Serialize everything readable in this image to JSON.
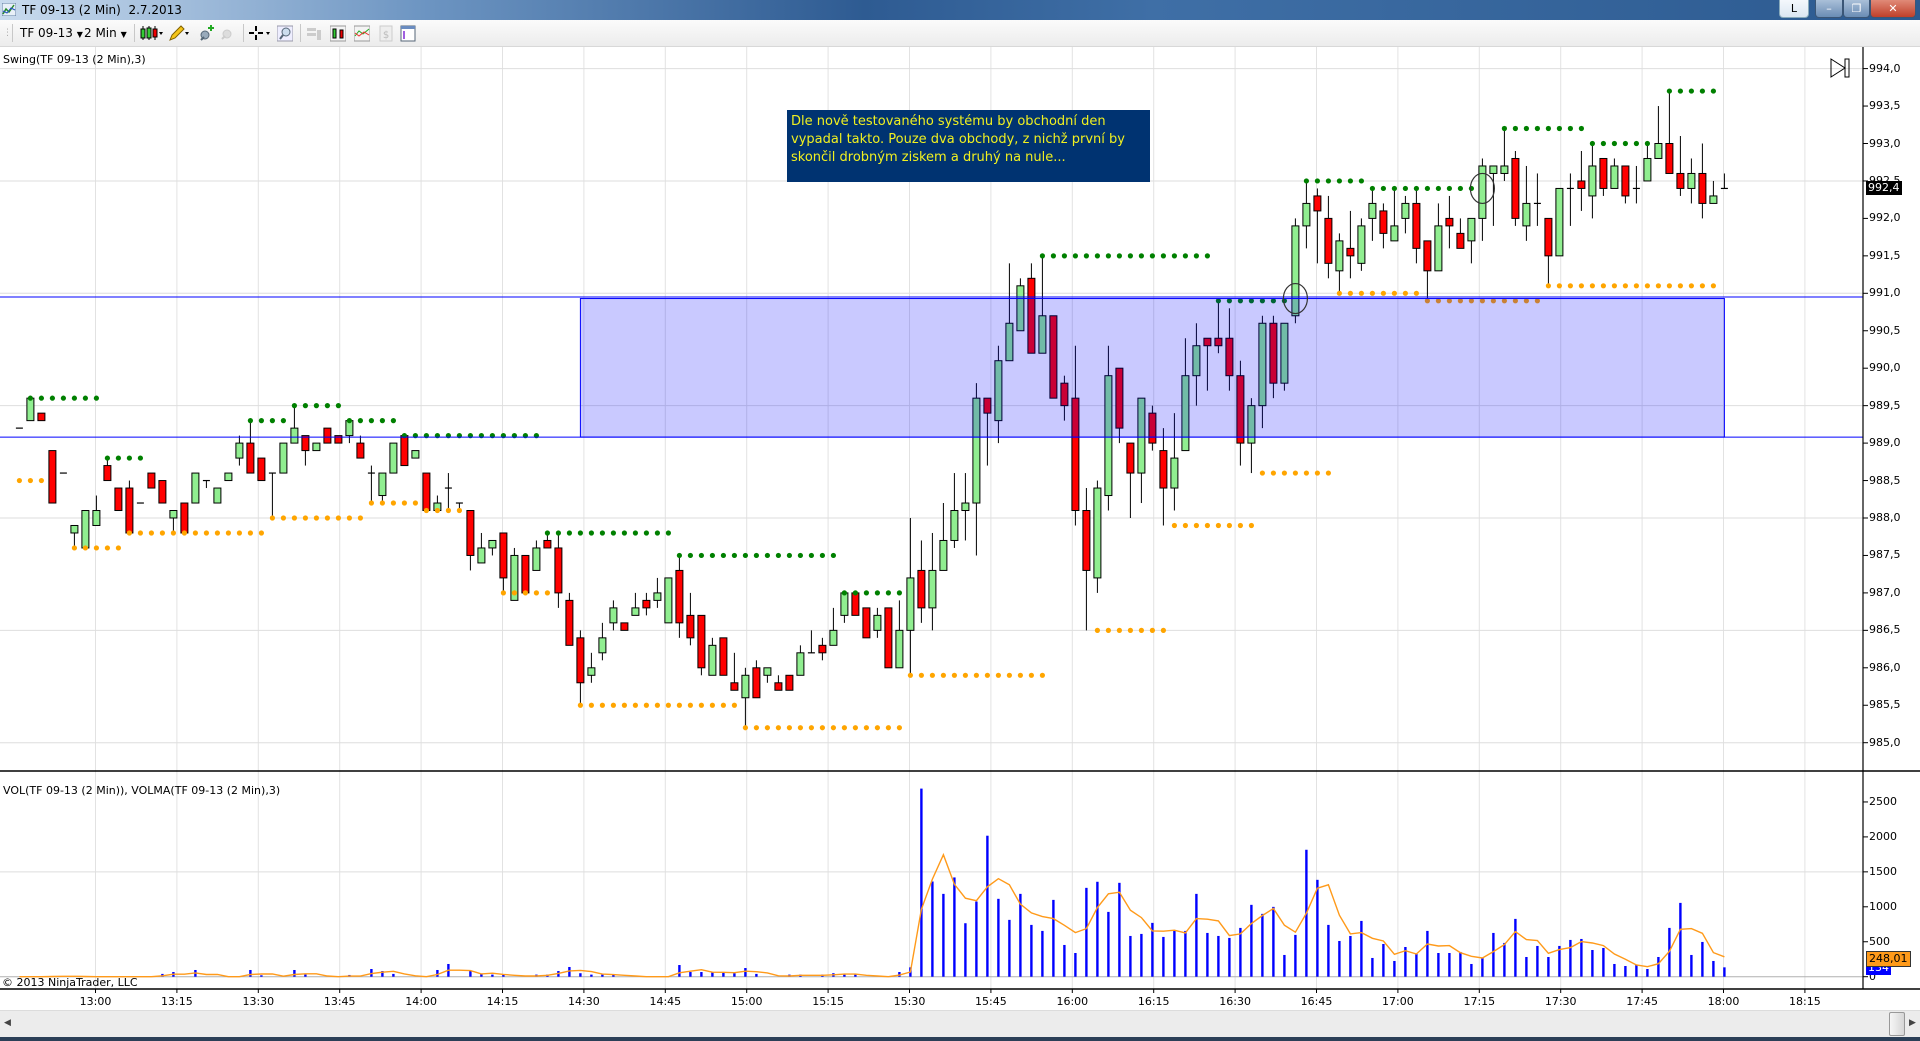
{
  "window": {
    "title": "TF 09-13 (2 Min)  2.7.2013",
    "link_button": "L"
  },
  "toolbar": {
    "instrument": "TF 09-13",
    "interval": "2 Min"
  },
  "labels": {
    "price_indicator": "Swing(TF 09-13 (2 Min),3)",
    "volume_indicator": "VOL(TF 09-13 (2 Min)), VOLMA(TF 09-13 (2 Min),3)",
    "copyright": "© 2013 NinjaTrader, LLC"
  },
  "annotation": {
    "text": "Dle nově testovaného systému by obchodní den vypadal takto. Pouze dva obchody, z nichž první by skončil drobným ziskem a druhý na nule..."
  },
  "colors": {
    "up": "#90ee90",
    "down": "#ff0000",
    "swing_high": "#008000",
    "swing_low": "#ffa500",
    "volume": "#0000ff",
    "volma": "#ff9a1a",
    "zone": "#0000ff",
    "annotation_bg": "#003371",
    "annotation_text": "#f0f020"
  },
  "markers": {
    "last_price": "992,4",
    "last_volma": "248,01",
    "last_volume": "134"
  },
  "chart_data": {
    "type": "candlestick",
    "instrument": "TF 09-13",
    "price_axis": {
      "min": 985.0,
      "max": 994.0,
      "step": 0.5,
      "labels": [
        "994,0",
        "993,5",
        "993,0",
        "992,5",
        "992,0",
        "991,5",
        "991,0",
        "990,5",
        "990,0",
        "989,5",
        "989,0",
        "988,5",
        "988,0",
        "987,5",
        "987,0",
        "986,5",
        "986,0",
        "985,5",
        "985,0"
      ],
      "grid_step": 1.5
    },
    "volume_axis": {
      "labels": [
        "2500",
        "2000",
        "1500",
        "1000",
        "500",
        "0"
      ],
      "values": [
        2500,
        2000,
        1500,
        1000,
        500,
        0
      ],
      "grid": [
        1500
      ]
    },
    "time_labels": [
      "13:00",
      "13:15",
      "13:30",
      "13:45",
      "14:00",
      "14:15",
      "14:30",
      "14:45",
      "15:00",
      "15:15",
      "15:30",
      "15:45",
      "16:00",
      "16:15",
      "16:30",
      "16:45",
      "17:00",
      "17:15",
      "17:30",
      "17:45",
      "18:00",
      "18:15"
    ],
    "candles_ohlc": [
      [
        989.2,
        989.2,
        989.2,
        989.2
      ],
      [
        989.3,
        989.6,
        989.3,
        989.6
      ],
      [
        989.4,
        989.4,
        989.3,
        989.3
      ],
      [
        988.9,
        988.9,
        988.2,
        988.2
      ],
      [
        988.6,
        988.6,
        988.6,
        988.6
      ],
      [
        987.8,
        987.9,
        987.6,
        987.9
      ],
      [
        987.6,
        988.1,
        987.6,
        988.1
      ],
      [
        987.9,
        988.3,
        987.9,
        988.1
      ],
      [
        988.7,
        988.8,
        988.5,
        988.5
      ],
      [
        988.4,
        988.4,
        988.1,
        988.1
      ],
      [
        988.4,
        988.5,
        987.8,
        987.8
      ],
      [
        988.2,
        988.2,
        988.2,
        988.2
      ],
      [
        988.6,
        988.6,
        988.4,
        988.4
      ],
      [
        988.5,
        988.5,
        988.2,
        988.2
      ],
      [
        988.0,
        988.1,
        987.8,
        988.1
      ],
      [
        988.2,
        988.2,
        987.8,
        987.8
      ],
      [
        988.2,
        988.6,
        988.2,
        988.6
      ],
      [
        988.5,
        988.5,
        988.4,
        988.5
      ],
      [
        988.2,
        988.4,
        988.2,
        988.4
      ],
      [
        988.5,
        988.6,
        988.5,
        988.6
      ],
      [
        988.8,
        989.1,
        988.7,
        989.0
      ],
      [
        989.0,
        989.3,
        988.6,
        988.6
      ],
      [
        988.8,
        988.8,
        988.5,
        988.5
      ],
      [
        988.6,
        988.6,
        988.0,
        988.6
      ],
      [
        988.6,
        989.0,
        988.6,
        989.0
      ],
      [
        989.0,
        989.5,
        989.0,
        989.2
      ],
      [
        989.1,
        989.1,
        988.7,
        988.9
      ],
      [
        988.9,
        989.0,
        988.9,
        989.0
      ],
      [
        989.2,
        989.2,
        989.0,
        989.0
      ],
      [
        989.1,
        989.1,
        989.0,
        989.0
      ],
      [
        989.1,
        989.3,
        989.0,
        989.3
      ],
      [
        989.0,
        989.1,
        988.8,
        988.8
      ],
      [
        988.6,
        988.7,
        988.2,
        988.6
      ],
      [
        988.3,
        988.6,
        988.2,
        988.6
      ],
      [
        988.6,
        989.0,
        988.6,
        989.0
      ],
      [
        989.1,
        989.1,
        988.7,
        988.7
      ],
      [
        988.8,
        988.9,
        988.8,
        988.9
      ],
      [
        988.6,
        988.6,
        988.1,
        988.1
      ],
      [
        988.1,
        988.3,
        988.1,
        988.2
      ],
      [
        988.4,
        988.6,
        988.1,
        988.4
      ],
      [
        988.2,
        988.2,
        988.1,
        988.2
      ],
      [
        988.1,
        988.1,
        987.3,
        987.5
      ],
      [
        987.4,
        987.8,
        987.4,
        987.6
      ],
      [
        987.6,
        987.7,
        987.5,
        987.7
      ],
      [
        987.8,
        987.8,
        987.0,
        987.2
      ],
      [
        986.9,
        987.6,
        986.9,
        987.5
      ],
      [
        987.5,
        987.5,
        987.0,
        987.0
      ],
      [
        987.3,
        987.7,
        987.3,
        987.6
      ],
      [
        987.7,
        987.8,
        987.6,
        987.6
      ],
      [
        987.6,
        987.8,
        986.8,
        987.0
      ],
      [
        986.9,
        987.0,
        986.3,
        986.3
      ],
      [
        986.4,
        986.5,
        985.5,
        985.8
      ],
      [
        985.9,
        986.2,
        985.8,
        986.0
      ],
      [
        986.2,
        986.6,
        986.1,
        986.4
      ],
      [
        986.6,
        986.9,
        986.5,
        986.8
      ],
      [
        986.6,
        986.6,
        986.5,
        986.5
      ],
      [
        986.7,
        987.0,
        986.7,
        986.8
      ],
      [
        986.9,
        987.0,
        986.7,
        986.8
      ],
      [
        986.9,
        987.2,
        986.8,
        987.0
      ],
      [
        986.6,
        987.2,
        986.6,
        987.2
      ],
      [
        987.3,
        987.5,
        986.4,
        986.6
      ],
      [
        986.7,
        987.0,
        986.3,
        986.4
      ],
      [
        986.7,
        986.7,
        985.9,
        986.0
      ],
      [
        985.9,
        986.4,
        985.9,
        986.3
      ],
      [
        986.4,
        986.4,
        985.9,
        985.9
      ],
      [
        985.8,
        986.2,
        985.7,
        985.7
      ],
      [
        985.6,
        986.0,
        985.2,
        985.9
      ],
      [
        986.0,
        986.1,
        985.6,
        985.6
      ],
      [
        985.9,
        986.0,
        985.8,
        986.0
      ],
      [
        985.8,
        985.9,
        985.7,
        985.7
      ],
      [
        985.9,
        985.9,
        985.7,
        985.7
      ],
      [
        985.9,
        986.3,
        985.9,
        986.2
      ],
      [
        986.2,
        986.5,
        986.2,
        986.2
      ],
      [
        986.3,
        986.4,
        986.1,
        986.2
      ],
      [
        986.3,
        986.8,
        986.3,
        986.5
      ],
      [
        986.7,
        987.0,
        986.6,
        987.0
      ],
      [
        987.0,
        987.0,
        986.7,
        986.7
      ],
      [
        986.8,
        986.8,
        986.4,
        986.4
      ],
      [
        986.5,
        986.8,
        986.4,
        986.7
      ],
      [
        986.8,
        986.8,
        986.0,
        986.0
      ],
      [
        986.0,
        986.9,
        986.0,
        986.5
      ],
      [
        986.5,
        988.0,
        985.9,
        987.2
      ],
      [
        987.3,
        987.7,
        986.6,
        986.8
      ],
      [
        986.8,
        987.8,
        986.5,
        987.3
      ],
      [
        987.3,
        988.2,
        987.3,
        987.7
      ],
      [
        987.7,
        988.6,
        987.6,
        988.1
      ],
      [
        988.1,
        988.6,
        987.7,
        988.2
      ],
      [
        988.2,
        989.8,
        987.5,
        989.6
      ],
      [
        989.6,
        989.6,
        988.7,
        989.4
      ],
      [
        989.3,
        990.3,
        989.0,
        990.1
      ],
      [
        990.1,
        991.4,
        990.1,
        990.6
      ],
      [
        990.5,
        991.2,
        990.5,
        991.1
      ],
      [
        991.2,
        991.4,
        990.2,
        990.2
      ],
      [
        990.2,
        991.5,
        990.2,
        990.7
      ],
      [
        990.7,
        990.7,
        989.6,
        989.6
      ],
      [
        989.8,
        989.9,
        989.3,
        989.5
      ],
      [
        989.6,
        990.3,
        987.9,
        988.1
      ],
      [
        988.1,
        988.4,
        986.5,
        987.3
      ],
      [
        987.2,
        988.5,
        987.0,
        988.4
      ],
      [
        988.3,
        990.3,
        988.1,
        989.9
      ],
      [
        990.0,
        990.0,
        989.0,
        989.2
      ],
      [
        989.0,
        989.0,
        988.0,
        988.6
      ],
      [
        988.6,
        989.6,
        988.2,
        989.6
      ],
      [
        989.4,
        989.5,
        988.9,
        989.0
      ],
      [
        988.9,
        989.2,
        987.9,
        988.4
      ],
      [
        988.4,
        989.4,
        988.1,
        988.8
      ],
      [
        988.9,
        990.4,
        988.9,
        989.9
      ],
      [
        989.9,
        990.6,
        989.5,
        990.3
      ],
      [
        990.4,
        990.4,
        989.7,
        990.3
      ],
      [
        990.4,
        990.9,
        990.2,
        990.3
      ],
      [
        990.4,
        990.8,
        989.7,
        989.9
      ],
      [
        989.9,
        990.1,
        988.7,
        989.0
      ],
      [
        989.0,
        989.6,
        988.6,
        989.5
      ],
      [
        989.5,
        990.7,
        989.2,
        990.6
      ],
      [
        990.6,
        990.7,
        989.6,
        989.8
      ],
      [
        989.8,
        990.6,
        989.7,
        990.6
      ],
      [
        990.7,
        992.0,
        990.6,
        991.9
      ],
      [
        991.9,
        992.5,
        991.6,
        992.2
      ],
      [
        992.3,
        992.4,
        991.4,
        992.1
      ],
      [
        992.0,
        992.3,
        991.2,
        991.4
      ],
      [
        991.3,
        991.8,
        991.0,
        991.7
      ],
      [
        991.6,
        992.1,
        991.2,
        991.5
      ],
      [
        991.4,
        992.0,
        991.3,
        991.9
      ],
      [
        992.0,
        992.4,
        991.7,
        992.2
      ],
      [
        992.1,
        992.2,
        991.6,
        991.8
      ],
      [
        991.7,
        992.4,
        991.7,
        991.9
      ],
      [
        992.0,
        992.3,
        991.8,
        992.2
      ],
      [
        992.2,
        992.4,
        991.4,
        991.6
      ],
      [
        991.7,
        991.7,
        990.9,
        991.3
      ],
      [
        991.3,
        992.2,
        991.3,
        991.9
      ],
      [
        992.0,
        992.3,
        991.6,
        991.9
      ],
      [
        991.8,
        992.0,
        991.6,
        991.6
      ],
      [
        991.7,
        992.0,
        991.4,
        992.0
      ],
      [
        992.0,
        992.8,
        991.7,
        992.7
      ],
      [
        992.6,
        992.7,
        991.9,
        992.7
      ],
      [
        992.6,
        993.2,
        992.5,
        992.7
      ],
      [
        992.8,
        992.9,
        991.9,
        992.0
      ],
      [
        991.9,
        992.7,
        991.7,
        992.2
      ],
      [
        992.2,
        992.6,
        991.9,
        992.2
      ],
      [
        992.0,
        992.0,
        991.1,
        991.5
      ],
      [
        991.5,
        992.4,
        991.5,
        992.4
      ],
      [
        992.4,
        992.6,
        991.9,
        992.4
      ],
      [
        992.5,
        992.9,
        992.1,
        992.4
      ],
      [
        992.3,
        993.0,
        992.0,
        992.7
      ],
      [
        992.8,
        992.8,
        992.3,
        992.4
      ],
      [
        992.4,
        992.8,
        992.4,
        992.7
      ],
      [
        992.7,
        992.7,
        992.2,
        992.3
      ],
      [
        992.4,
        992.7,
        992.2,
        992.4
      ],
      [
        992.5,
        993.0,
        992.5,
        992.8
      ],
      [
        992.8,
        993.5,
        992.8,
        993.0
      ],
      [
        993.0,
        993.7,
        992.6,
        992.6
      ],
      [
        992.6,
        993.1,
        992.3,
        992.4
      ],
      [
        992.4,
        992.8,
        992.2,
        992.6
      ],
      [
        992.6,
        993.0,
        992.0,
        992.2
      ],
      [
        992.2,
        992.5,
        992.2,
        992.3
      ],
      [
        992.4,
        992.6,
        992.4,
        992.4
      ]
    ],
    "volume": [
      0,
      0,
      0,
      10,
      8,
      0,
      0,
      0,
      0,
      0,
      0,
      0,
      0,
      40,
      67,
      0,
      96,
      0,
      0,
      0,
      0,
      96,
      20,
      0,
      0,
      96,
      30,
      0,
      0,
      0,
      25,
      0,
      110,
      81,
      40,
      0,
      0,
      0,
      96,
      182,
      0,
      81,
      40,
      30,
      30,
      0,
      0,
      30,
      30,
      81,
      139,
      50,
      30,
      30,
      30,
      0,
      0,
      0,
      0,
      0,
      167,
      67,
      67,
      60,
      60,
      50,
      124,
      40,
      0,
      0,
      30,
      30,
      0,
      30,
      50,
      30,
      30,
      0,
      0,
      0,
      67,
      134,
      2691,
      1362,
      1185,
      1420,
      765,
      1075,
      2017,
      1114,
      813,
      1185,
      741,
      655,
      1099,
      454,
      339,
      1271,
      1358,
      927,
      1343,
      583,
      612,
      770,
      569,
      655,
      655,
      1185,
      626,
      583,
      555,
      698,
      1028,
      899,
      999,
      311,
      598,
      1816,
      1386,
      741,
      511,
      583,
      798,
      268,
      468,
      225,
      425,
      325,
      655,
      339,
      339,
      354,
      182,
      268,
      626,
      483,
      827,
      282,
      440,
      282,
      440,
      526,
      540,
      382,
      411,
      182,
      153,
      167,
      110,
      282,
      698,
      1056,
      311,
      497,
      225,
      134
    ],
    "volma_period": 3,
    "swing_highs": [
      [
        1,
        7,
        989.6
      ],
      [
        8,
        11,
        988.8
      ],
      [
        21,
        24,
        989.3
      ],
      [
        25,
        29,
        989.5
      ],
      [
        30,
        34,
        989.3
      ],
      [
        35,
        47,
        989.1
      ],
      [
        48,
        59,
        987.8
      ],
      [
        60,
        74,
        987.5
      ],
      [
        75,
        80,
        987.0
      ],
      [
        93,
        108,
        991.5
      ],
      [
        109,
        115,
        990.9
      ],
      [
        117,
        122,
        992.5
      ],
      [
        123,
        132,
        992.4
      ],
      [
        135,
        142,
        993.2
      ],
      [
        143,
        148,
        993.0
      ],
      [
        150,
        154,
        993.7
      ]
    ],
    "swing_lows": [
      [
        0,
        2,
        988.5
      ],
      [
        5,
        9,
        987.6
      ],
      [
        10,
        22,
        987.8
      ],
      [
        23,
        31,
        988.0
      ],
      [
        32,
        36,
        988.2
      ],
      [
        37,
        40,
        988.1
      ],
      [
        44,
        48,
        987.0
      ],
      [
        51,
        65,
        985.5
      ],
      [
        66,
        80,
        985.2
      ],
      [
        81,
        93,
        985.9
      ],
      [
        98,
        104,
        986.5
      ],
      [
        105,
        112,
        987.9
      ],
      [
        113,
        119,
        988.6
      ],
      [
        120,
        127,
        991.0
      ],
      [
        128,
        138,
        990.9
      ],
      [
        139,
        154,
        991.1
      ]
    ],
    "zone": {
      "from_bar": 51,
      "to_bar": 155,
      "top": 990.93,
      "bottom": 989.08
    },
    "hlines": [
      990.95,
      989.08
    ],
    "entry_markers": [
      [
        116,
        990.93
      ],
      [
        133,
        992.4
      ]
    ]
  }
}
